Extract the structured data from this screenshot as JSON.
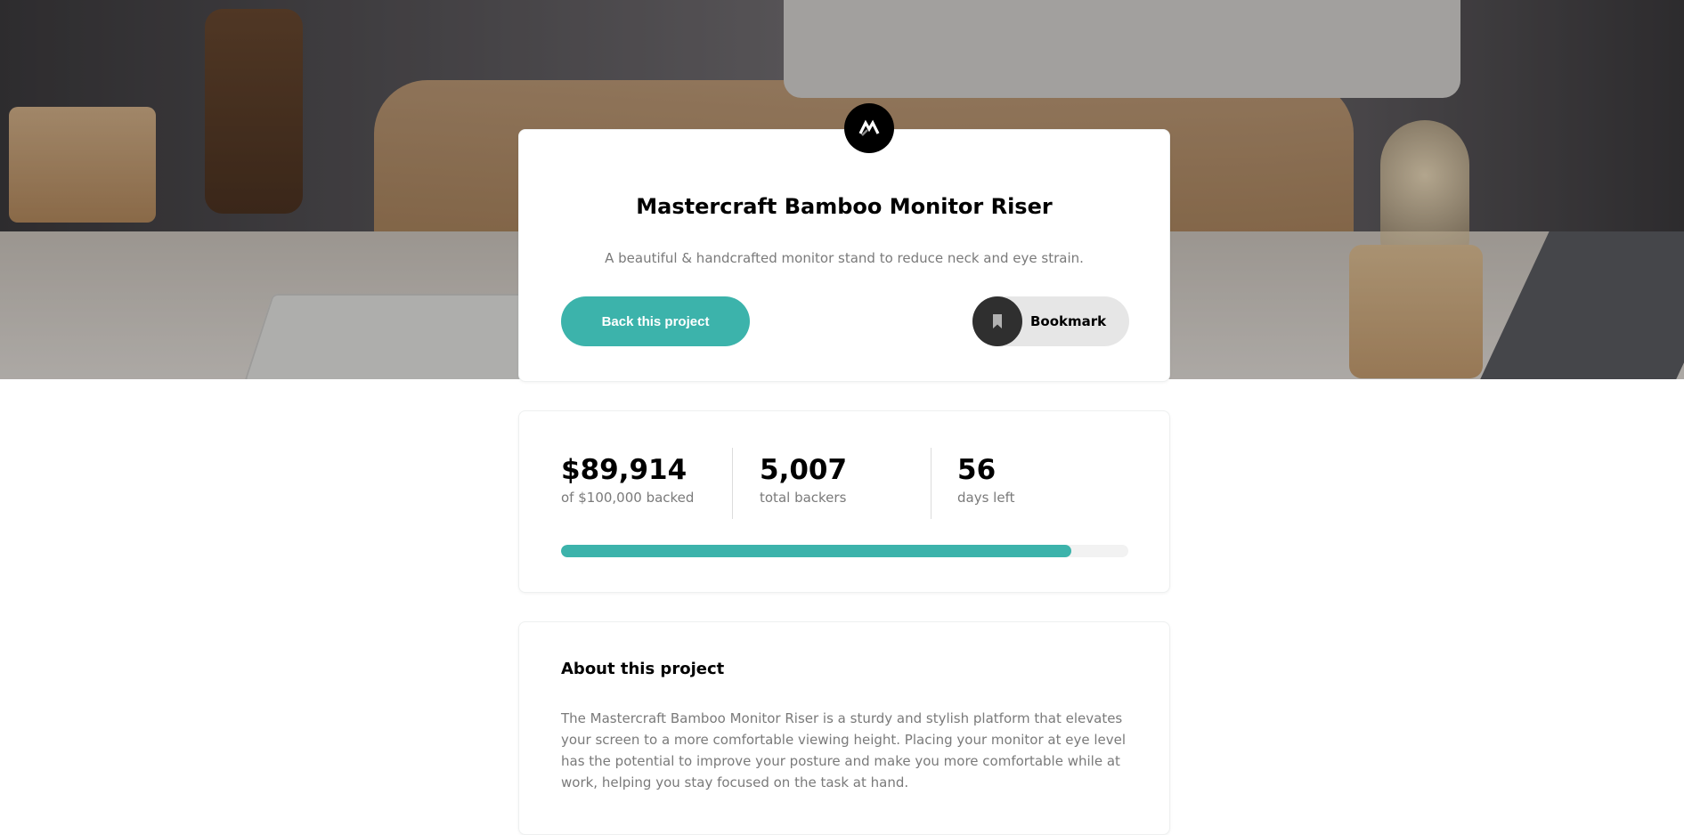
{
  "hero": {
    "image_description": "desk with bamboo monitor riser"
  },
  "project": {
    "title": "Mastercraft Bamboo Monitor Riser",
    "subtitle": "A beautiful & handcrafted monitor stand to reduce neck and eye strain.",
    "back_button_label": "Back this project",
    "bookmark_label": "Bookmark"
  },
  "stats": {
    "amount": "$89,914",
    "amount_label": "of $100,000 backed",
    "backers": "5,007",
    "backers_label": "total backers",
    "days": "56",
    "days_label": "days left",
    "progress_fraction": 0.89914
  },
  "about": {
    "title": "About this project",
    "text": "The Mastercraft Bamboo Monitor Riser is a sturdy and stylish platform that elevates your screen to a more comfortable viewing height. Placing your monitor at eye level has the potential to improve your posture and make you more comfortable while at work, helping you stay focused on the task at hand."
  },
  "colors": {
    "accent": "#3cb3ab",
    "dark": "#2f2f2f",
    "muted_text": "#7a7a7a"
  },
  "icons": {
    "logo": "mastercraft-logo-icon",
    "bookmark": "bookmark-icon"
  }
}
